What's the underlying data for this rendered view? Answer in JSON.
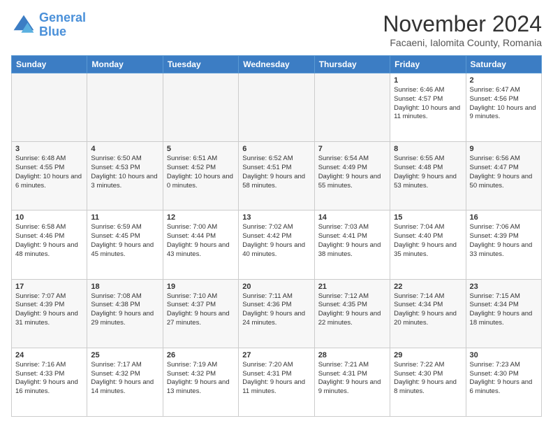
{
  "header": {
    "logo_line1": "General",
    "logo_line2": "Blue",
    "month_title": "November 2024",
    "location": "Facaeni, Ialomita County, Romania"
  },
  "days_of_week": [
    "Sunday",
    "Monday",
    "Tuesday",
    "Wednesday",
    "Thursday",
    "Friday",
    "Saturday"
  ],
  "weeks": [
    [
      {
        "day": "",
        "info": ""
      },
      {
        "day": "",
        "info": ""
      },
      {
        "day": "",
        "info": ""
      },
      {
        "day": "",
        "info": ""
      },
      {
        "day": "",
        "info": ""
      },
      {
        "day": "1",
        "info": "Sunrise: 6:46 AM\nSunset: 4:57 PM\nDaylight: 10 hours and 11 minutes."
      },
      {
        "day": "2",
        "info": "Sunrise: 6:47 AM\nSunset: 4:56 PM\nDaylight: 10 hours and 9 minutes."
      }
    ],
    [
      {
        "day": "3",
        "info": "Sunrise: 6:48 AM\nSunset: 4:55 PM\nDaylight: 10 hours and 6 minutes."
      },
      {
        "day": "4",
        "info": "Sunrise: 6:50 AM\nSunset: 4:53 PM\nDaylight: 10 hours and 3 minutes."
      },
      {
        "day": "5",
        "info": "Sunrise: 6:51 AM\nSunset: 4:52 PM\nDaylight: 10 hours and 0 minutes."
      },
      {
        "day": "6",
        "info": "Sunrise: 6:52 AM\nSunset: 4:51 PM\nDaylight: 9 hours and 58 minutes."
      },
      {
        "day": "7",
        "info": "Sunrise: 6:54 AM\nSunset: 4:49 PM\nDaylight: 9 hours and 55 minutes."
      },
      {
        "day": "8",
        "info": "Sunrise: 6:55 AM\nSunset: 4:48 PM\nDaylight: 9 hours and 53 minutes."
      },
      {
        "day": "9",
        "info": "Sunrise: 6:56 AM\nSunset: 4:47 PM\nDaylight: 9 hours and 50 minutes."
      }
    ],
    [
      {
        "day": "10",
        "info": "Sunrise: 6:58 AM\nSunset: 4:46 PM\nDaylight: 9 hours and 48 minutes."
      },
      {
        "day": "11",
        "info": "Sunrise: 6:59 AM\nSunset: 4:45 PM\nDaylight: 9 hours and 45 minutes."
      },
      {
        "day": "12",
        "info": "Sunrise: 7:00 AM\nSunset: 4:44 PM\nDaylight: 9 hours and 43 minutes."
      },
      {
        "day": "13",
        "info": "Sunrise: 7:02 AM\nSunset: 4:42 PM\nDaylight: 9 hours and 40 minutes."
      },
      {
        "day": "14",
        "info": "Sunrise: 7:03 AM\nSunset: 4:41 PM\nDaylight: 9 hours and 38 minutes."
      },
      {
        "day": "15",
        "info": "Sunrise: 7:04 AM\nSunset: 4:40 PM\nDaylight: 9 hours and 35 minutes."
      },
      {
        "day": "16",
        "info": "Sunrise: 7:06 AM\nSunset: 4:39 PM\nDaylight: 9 hours and 33 minutes."
      }
    ],
    [
      {
        "day": "17",
        "info": "Sunrise: 7:07 AM\nSunset: 4:39 PM\nDaylight: 9 hours and 31 minutes."
      },
      {
        "day": "18",
        "info": "Sunrise: 7:08 AM\nSunset: 4:38 PM\nDaylight: 9 hours and 29 minutes."
      },
      {
        "day": "19",
        "info": "Sunrise: 7:10 AM\nSunset: 4:37 PM\nDaylight: 9 hours and 27 minutes."
      },
      {
        "day": "20",
        "info": "Sunrise: 7:11 AM\nSunset: 4:36 PM\nDaylight: 9 hours and 24 minutes."
      },
      {
        "day": "21",
        "info": "Sunrise: 7:12 AM\nSunset: 4:35 PM\nDaylight: 9 hours and 22 minutes."
      },
      {
        "day": "22",
        "info": "Sunrise: 7:14 AM\nSunset: 4:34 PM\nDaylight: 9 hours and 20 minutes."
      },
      {
        "day": "23",
        "info": "Sunrise: 7:15 AM\nSunset: 4:34 PM\nDaylight: 9 hours and 18 minutes."
      }
    ],
    [
      {
        "day": "24",
        "info": "Sunrise: 7:16 AM\nSunset: 4:33 PM\nDaylight: 9 hours and 16 minutes."
      },
      {
        "day": "25",
        "info": "Sunrise: 7:17 AM\nSunset: 4:32 PM\nDaylight: 9 hours and 14 minutes."
      },
      {
        "day": "26",
        "info": "Sunrise: 7:19 AM\nSunset: 4:32 PM\nDaylight: 9 hours and 13 minutes."
      },
      {
        "day": "27",
        "info": "Sunrise: 7:20 AM\nSunset: 4:31 PM\nDaylight: 9 hours and 11 minutes."
      },
      {
        "day": "28",
        "info": "Sunrise: 7:21 AM\nSunset: 4:31 PM\nDaylight: 9 hours and 9 minutes."
      },
      {
        "day": "29",
        "info": "Sunrise: 7:22 AM\nSunset: 4:30 PM\nDaylight: 9 hours and 8 minutes."
      },
      {
        "day": "30",
        "info": "Sunrise: 7:23 AM\nSunset: 4:30 PM\nDaylight: 9 hours and 6 minutes."
      }
    ]
  ]
}
